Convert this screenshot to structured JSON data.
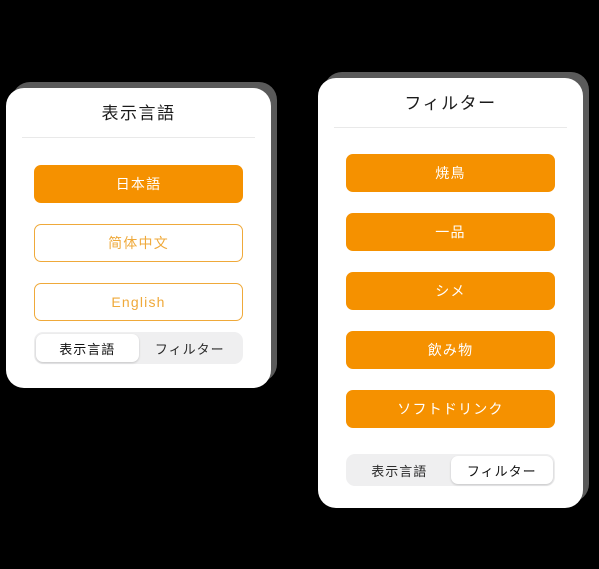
{
  "background_color": "#000000",
  "theme": {
    "accent": "#f59100",
    "accent_outline": "#efa93a",
    "card_bg": "#ffffff",
    "bezel": "#5a5a5a",
    "tabbar_track": "#efeff0",
    "divider": "#e9e9e9"
  },
  "panels": [
    {
      "id": "language-panel",
      "title": "表示言語",
      "options": [
        {
          "label": "日本語",
          "style": "filled",
          "selected": true
        },
        {
          "label": "简体中文",
          "style": "outlined",
          "selected": false
        },
        {
          "label": "English",
          "style": "outlined",
          "selected": false
        }
      ],
      "tabs": [
        {
          "label": "表示言語",
          "active": true
        },
        {
          "label": "フィルター",
          "active": false
        }
      ]
    },
    {
      "id": "filter-panel",
      "title": "フィルター",
      "options": [
        {
          "label": "焼鳥",
          "style": "filled",
          "selected": true
        },
        {
          "label": "一品",
          "style": "filled",
          "selected": true
        },
        {
          "label": "シメ",
          "style": "filled",
          "selected": true
        },
        {
          "label": "飲み物",
          "style": "filled",
          "selected": true
        },
        {
          "label": "ソフトドリンク",
          "style": "filled",
          "selected": true
        }
      ],
      "tabs": [
        {
          "label": "表示言語",
          "active": false
        },
        {
          "label": "フィルター",
          "active": true
        }
      ]
    }
  ]
}
